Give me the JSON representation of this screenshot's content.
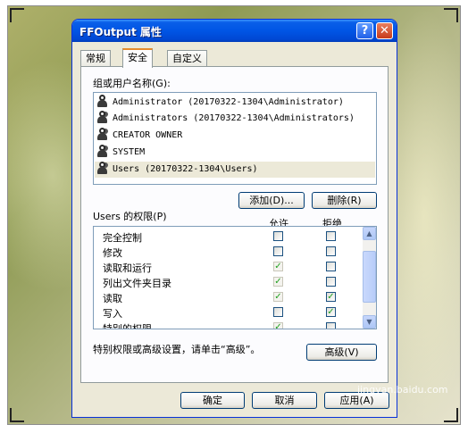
{
  "window": {
    "title": "FFOutput 属性",
    "help_glyph": "?",
    "close_glyph": "✕"
  },
  "tabs": [
    {
      "label": "常规"
    },
    {
      "label": "安全"
    },
    {
      "label": "自定义"
    }
  ],
  "security": {
    "group_label": "组或用户名称(G):",
    "principals": [
      {
        "name": "Administrator (20170322-1304\\Administrator)",
        "icon": "user-icon"
      },
      {
        "name": "Administrators (20170322-1304\\Administrators)",
        "icon": "group-icon"
      },
      {
        "name": "CREATOR OWNER",
        "icon": "group-icon"
      },
      {
        "name": "SYSTEM",
        "icon": "group-icon"
      },
      {
        "name": "Users (20170322-1304\\Users)",
        "icon": "group-icon",
        "selected": true
      }
    ],
    "add_button": "添加(D)...",
    "remove_button": "删除(R)",
    "permissions_label": "Users 的权限(P)",
    "allow_header": "允许",
    "deny_header": "拒绝",
    "check_glyph": "✓",
    "permissions": [
      {
        "name": "完全控制",
        "allow": false,
        "allow_disabled": false,
        "deny": false
      },
      {
        "name": "修改",
        "allow": false,
        "allow_disabled": false,
        "deny": false
      },
      {
        "name": "读取和运行",
        "allow": true,
        "allow_disabled": true,
        "deny": false
      },
      {
        "name": "列出文件夹目录",
        "allow": true,
        "allow_disabled": true,
        "deny": false
      },
      {
        "name": "读取",
        "allow": true,
        "allow_disabled": true,
        "deny": true
      },
      {
        "name": "写入",
        "allow": false,
        "allow_disabled": false,
        "deny": true
      },
      {
        "name": "特别的权限",
        "allow": true,
        "allow_disabled": true,
        "deny": false
      }
    ],
    "advanced_hint": "特别权限或高级设置，请单击“高级”。",
    "advanced_button": "高级(V)"
  },
  "footer": {
    "ok_button": "确定",
    "cancel_button": "取消",
    "apply_button": "应用(A)"
  },
  "watermark": "jingyan.baidu.com",
  "colors": {
    "titlebar": "#0055e5",
    "dialog_bg": "#ece9d8",
    "tab_accent": "#e68b2c",
    "check": "#21a121"
  }
}
